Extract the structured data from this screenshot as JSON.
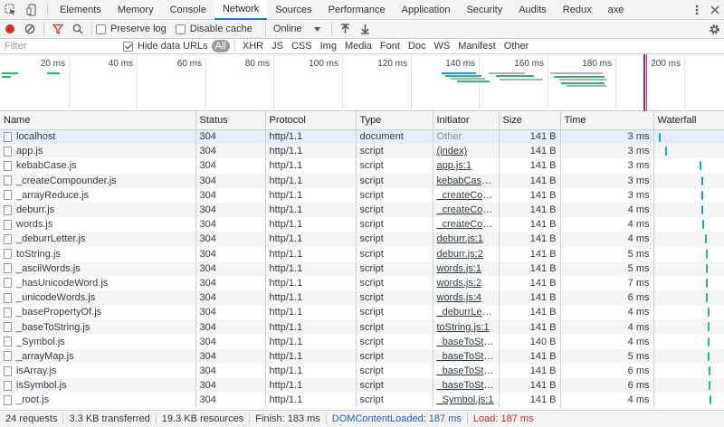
{
  "tabs": [
    "Elements",
    "Memory",
    "Console",
    "Network",
    "Sources",
    "Performance",
    "Application",
    "Security",
    "Audits",
    "Redux",
    "axe"
  ],
  "toolbar": {
    "preserve_log": "Preserve log",
    "disable_cache": "Disable cache",
    "throttle": "Online"
  },
  "filter": {
    "placeholder": "Filter",
    "hide_data_urls": "Hide data URLs",
    "types": [
      "All",
      "XHR",
      "JS",
      "CSS",
      "Img",
      "Media",
      "Font",
      "Doc",
      "WS",
      "Manifest",
      "Other"
    ]
  },
  "overview": {
    "ticks": [
      "20 ms",
      "40 ms",
      "60 ms",
      "80 ms",
      "100 ms",
      "120 ms",
      "140 ms",
      "160 ms",
      "180 ms",
      "200 ms"
    ]
  },
  "columns": [
    "Name",
    "Status",
    "Protocol",
    "Type",
    "Initiator",
    "Size",
    "Time",
    "Waterfall"
  ],
  "rows": [
    {
      "name": "localhost",
      "status": "304",
      "protocol": "http/1.1",
      "type": "document",
      "initiator": "Other",
      "size": "141 B",
      "time": "3 ms",
      "wf": 0.02
    },
    {
      "name": "app.js",
      "status": "304",
      "protocol": "http/1.1",
      "type": "script",
      "initiator": "(index)",
      "size": "141 B",
      "time": "3 ms",
      "wf": 0.12
    },
    {
      "name": "kebabCase.js",
      "status": "304",
      "protocol": "http/1.1",
      "type": "script",
      "initiator": "app.js:1",
      "size": "141 B",
      "time": "3 ms",
      "wf": 0.7
    },
    {
      "name": "_createCompounder.js",
      "status": "304",
      "protocol": "http/1.1",
      "type": "script",
      "initiator": "kebabCase.js:1",
      "size": "141 B",
      "time": "3 ms",
      "wf": 0.72
    },
    {
      "name": "_arrayReduce.js",
      "status": "304",
      "protocol": "http/1.1",
      "type": "script",
      "initiator": "_createComp…",
      "size": "141 B",
      "time": "3 ms",
      "wf": 0.73
    },
    {
      "name": "deburr.js",
      "status": "304",
      "protocol": "http/1.1",
      "type": "script",
      "initiator": "_createComp…",
      "size": "141 B",
      "time": "4 ms",
      "wf": 0.73
    },
    {
      "name": "words.js",
      "status": "304",
      "protocol": "http/1.1",
      "type": "script",
      "initiator": "_createComp…",
      "size": "141 B",
      "time": "4 ms",
      "wf": 0.74
    },
    {
      "name": "_deburrLetter.js",
      "status": "304",
      "protocol": "http/1.1",
      "type": "script",
      "initiator": "deburr.js:1",
      "size": "141 B",
      "time": "4 ms",
      "wf": 0.79
    },
    {
      "name": "toString.js",
      "status": "304",
      "protocol": "http/1.1",
      "type": "script",
      "initiator": "deburr.js:2",
      "size": "141 B",
      "time": "5 ms",
      "wf": 0.8
    },
    {
      "name": "_asciiWords.js",
      "status": "304",
      "protocol": "http/1.1",
      "type": "script",
      "initiator": "words.js:1",
      "size": "141 B",
      "time": "5 ms",
      "wf": 0.8
    },
    {
      "name": "_hasUnicodeWord.js",
      "status": "304",
      "protocol": "http/1.1",
      "type": "script",
      "initiator": "words.js:2",
      "size": "141 B",
      "time": "7 ms",
      "wf": 0.8
    },
    {
      "name": "_unicodeWords.js",
      "status": "304",
      "protocol": "http/1.1",
      "type": "script",
      "initiator": "words.js:4",
      "size": "141 B",
      "time": "6 ms",
      "wf": 0.8
    },
    {
      "name": "_basePropertyOf.js",
      "status": "304",
      "protocol": "http/1.1",
      "type": "script",
      "initiator": "_deburrLetter…",
      "size": "141 B",
      "time": "4 ms",
      "wf": 0.83
    },
    {
      "name": "_baseToString.js",
      "status": "304",
      "protocol": "http/1.1",
      "type": "script",
      "initiator": "toString.js:1",
      "size": "141 B",
      "time": "4 ms",
      "wf": 0.83
    },
    {
      "name": "_Symbol.js",
      "status": "304",
      "protocol": "http/1.1",
      "type": "script",
      "initiator": "_baseToStrin…",
      "size": "140 B",
      "time": "4 ms",
      "wf": 0.84
    },
    {
      "name": "_arrayMap.js",
      "status": "304",
      "protocol": "http/1.1",
      "type": "script",
      "initiator": "_baseToStrin…",
      "size": "141 B",
      "time": "5 ms",
      "wf": 0.84
    },
    {
      "name": "isArray.js",
      "status": "304",
      "protocol": "http/1.1",
      "type": "script",
      "initiator": "_baseToStrin…",
      "size": "141 B",
      "time": "6 ms",
      "wf": 0.85
    },
    {
      "name": "isSymbol.js",
      "status": "304",
      "protocol": "http/1.1",
      "type": "script",
      "initiator": "_baseToStrin…",
      "size": "141 B",
      "time": "6 ms",
      "wf": 0.85
    },
    {
      "name": "_root.js",
      "status": "304",
      "protocol": "http/1.1",
      "type": "script",
      "initiator": "_Symbol.js:1",
      "size": "141 B",
      "time": "4 ms",
      "wf": 0.86
    }
  ],
  "status": {
    "requests": "24 requests",
    "transferred": "3.3 KB transferred",
    "resources": "19.3 KB resources",
    "finish": "Finish: 183 ms",
    "dcl": "DOMContentLoaded: 187 ms",
    "load": "Load: 187 ms"
  },
  "colors": {
    "accent": "#1a73e8",
    "record": "#d93025",
    "filter_icon": "#d93025",
    "wf_blue": "#1a9bd7",
    "wf_green": "#2bb673"
  }
}
